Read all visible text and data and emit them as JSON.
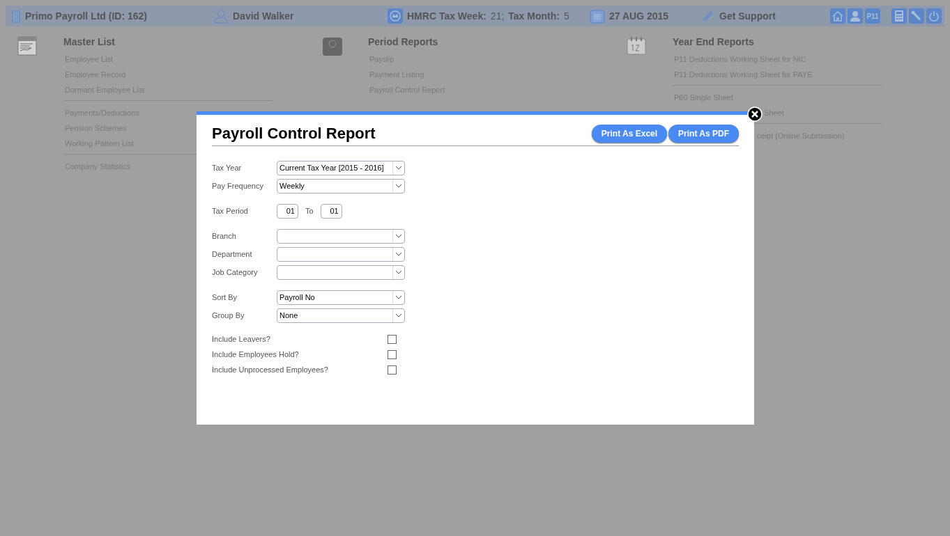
{
  "top_bar": {
    "company": "Primo Payroll Ltd (ID: 162)",
    "user": "David Walker",
    "tax_week_label": "HMRC Tax Week:",
    "tax_week": "21;",
    "tax_month_label": "Tax Month:",
    "tax_month": "5",
    "date": "27 AUG 2015",
    "support": "Get Support",
    "p11": "P11"
  },
  "menus": [
    {
      "title": "Master List",
      "groups": [
        [
          {
            "label": "Employee List"
          },
          {
            "label": "Employee Record"
          },
          {
            "label": "Dormant Employee List"
          }
        ],
        [
          {
            "label": "Payments/Deductions"
          },
          {
            "label": "Pension Schemes"
          },
          {
            "label": "Working Pattern List"
          }
        ],
        [
          {
            "label": "Company Statistics"
          }
        ]
      ]
    },
    {
      "title": "Period Reports",
      "groups": [
        [
          {
            "label": "Payslip"
          },
          {
            "label": "Payment Listing"
          },
          {
            "label": "Payroll Control Report"
          }
        ]
      ]
    },
    {
      "title": "Year End Reports",
      "groups": [
        [
          {
            "label": "P11 Deductions Working Sheet for NIC"
          },
          {
            "label": "P11 Deductions Working Sheet for PAYE"
          }
        ],
        [
          {
            "label": "P60 Single Sheet"
          },
          {
            "label": "Sheet",
            "kind": "partial-far"
          }
        ],
        [
          {
            "label": "ceipt (Online Submission)",
            "kind": "partial"
          }
        ]
      ]
    }
  ],
  "dialog": {
    "title": "Payroll Control Report",
    "buttons": [
      "Print As Excel",
      "Print As PDF"
    ],
    "groups": [
      [
        {
          "kind": "select",
          "label": "Tax Year",
          "value": "Current Tax Year [2015 - 2016]"
        },
        {
          "kind": "select",
          "label": "Pay Frequency",
          "value": "Weekly"
        }
      ],
      [
        {
          "kind": "period",
          "label": "Tax Period",
          "from": "01",
          "to_label": "To",
          "to": "01"
        }
      ],
      [
        {
          "kind": "select",
          "label": "Branch"
        },
        {
          "kind": "select",
          "label": "Department"
        },
        {
          "kind": "select",
          "label": "Job Category"
        }
      ],
      [
        {
          "kind": "select",
          "label": "Sort By",
          "value": "Payroll No"
        },
        {
          "kind": "select",
          "label": "Group By",
          "value": "None"
        }
      ],
      [
        {
          "kind": "checkbox",
          "label": "Include Leavers?",
          "checked": false
        },
        {
          "kind": "checkbox",
          "label": "Include Employees Hold?",
          "checked": false
        },
        {
          "kind": "checkbox",
          "label": "Include Unprocessed Employees?",
          "checked": false
        }
      ]
    ]
  }
}
